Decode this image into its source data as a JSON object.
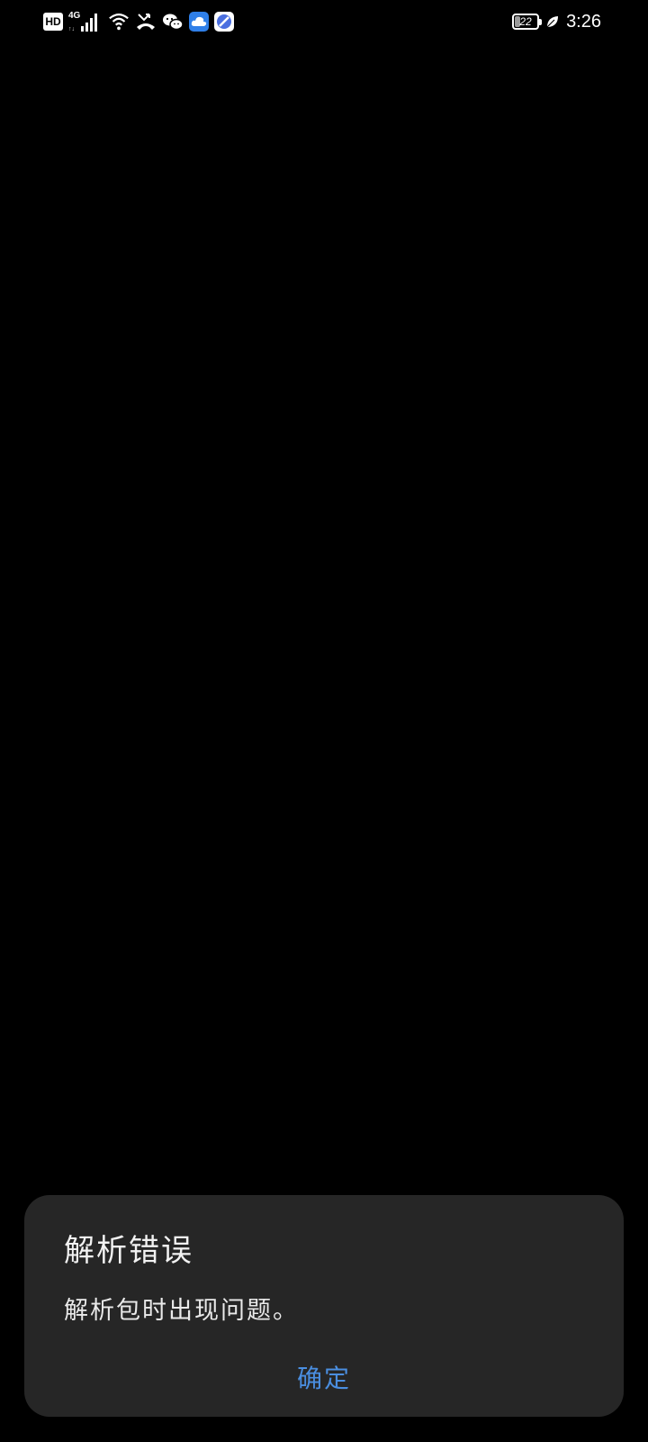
{
  "status_bar": {
    "hd_label": "HD",
    "network_label": "4G",
    "battery_level": "22",
    "battery_fraction": 0.22,
    "time": "3:26",
    "icons": [
      "hd-icon",
      "signal-4g-icon",
      "wifi-icon",
      "missed-call-icon",
      "wechat-icon",
      "cloud-app-icon",
      "browser-app-icon",
      "battery-icon",
      "leaf-icon"
    ]
  },
  "dialog": {
    "title": "解析错误",
    "message": "解析包时出现问题。",
    "confirm_label": "确定"
  },
  "colors": {
    "background": "#000000",
    "dialog_background": "#262626",
    "accent": "#4a8ee0"
  }
}
